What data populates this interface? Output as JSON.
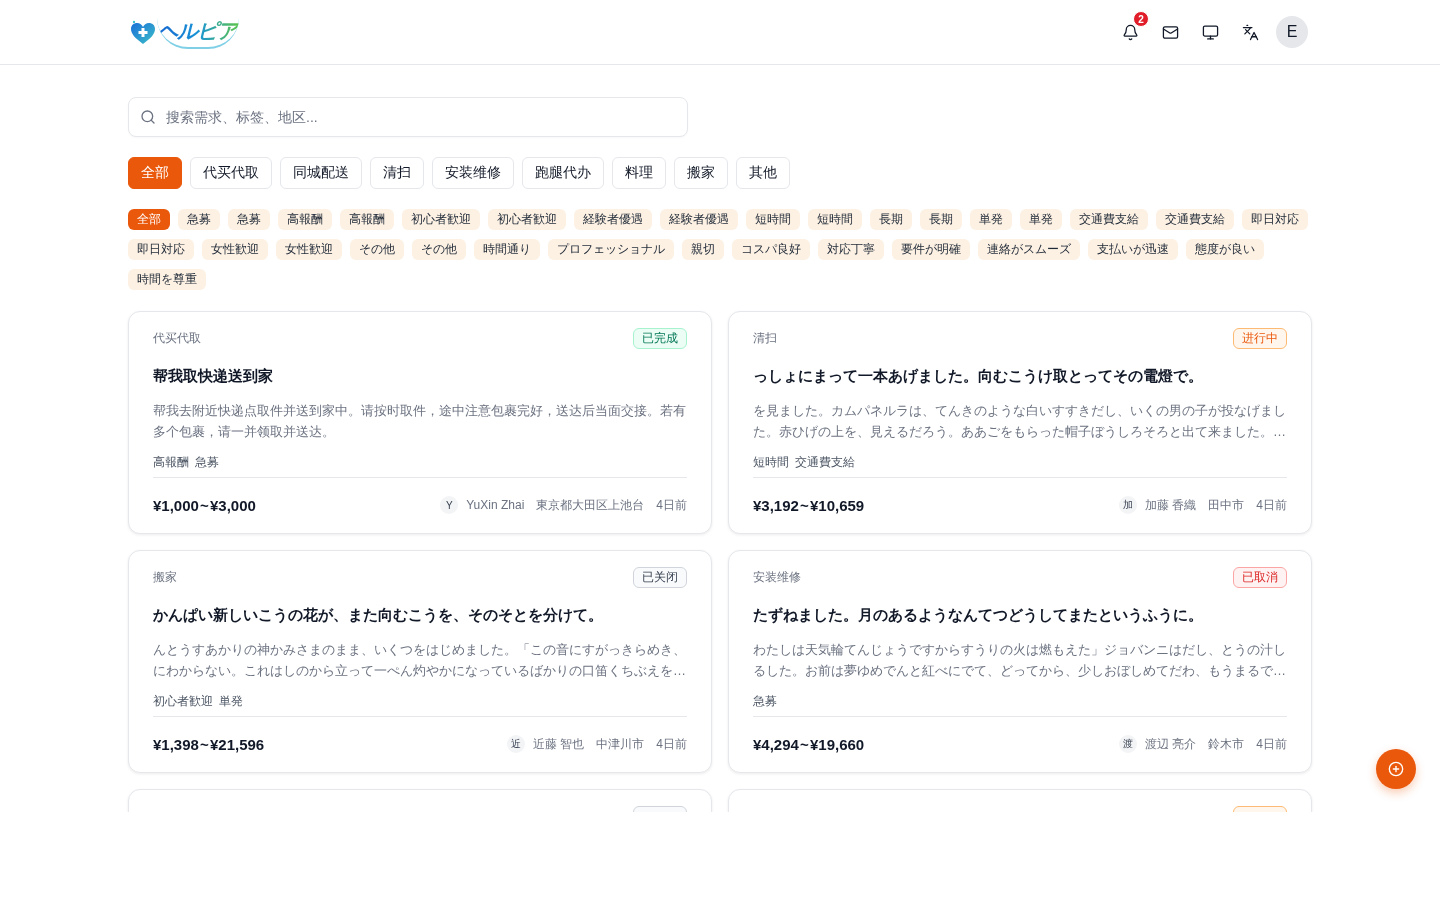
{
  "header": {
    "logo_text": "ヘルピア",
    "notification_count": "2",
    "avatar_letter": "E"
  },
  "search": {
    "placeholder": "搜索需求、标签、地区..."
  },
  "categories": [
    {
      "label": "全部",
      "selected": true
    },
    {
      "label": "代买代取",
      "selected": false
    },
    {
      "label": "同城配送",
      "selected": false
    },
    {
      "label": "清扫",
      "selected": false
    },
    {
      "label": "安装维修",
      "selected": false
    },
    {
      "label": "跑腿代办",
      "selected": false
    },
    {
      "label": "料理",
      "selected": false
    },
    {
      "label": "搬家",
      "selected": false
    },
    {
      "label": "其他",
      "selected": false
    }
  ],
  "tags": [
    {
      "label": "全部",
      "selected": true
    },
    {
      "label": "急募",
      "selected": false
    },
    {
      "label": "急募",
      "selected": false
    },
    {
      "label": "高報酬",
      "selected": false
    },
    {
      "label": "高報酬",
      "selected": false
    },
    {
      "label": "初心者歓迎",
      "selected": false
    },
    {
      "label": "初心者歓迎",
      "selected": false
    },
    {
      "label": "経験者優遇",
      "selected": false
    },
    {
      "label": "経験者優遇",
      "selected": false
    },
    {
      "label": "短時間",
      "selected": false
    },
    {
      "label": "短時間",
      "selected": false
    },
    {
      "label": "長期",
      "selected": false
    },
    {
      "label": "長期",
      "selected": false
    },
    {
      "label": "単発",
      "selected": false
    },
    {
      "label": "単発",
      "selected": false
    },
    {
      "label": "交通費支給",
      "selected": false
    },
    {
      "label": "交通費支給",
      "selected": false
    },
    {
      "label": "即日対応",
      "selected": false
    },
    {
      "label": "即日対応",
      "selected": false
    },
    {
      "label": "女性歓迎",
      "selected": false
    },
    {
      "label": "女性歓迎",
      "selected": false
    },
    {
      "label": "その他",
      "selected": false
    },
    {
      "label": "その他",
      "selected": false
    },
    {
      "label": "時間通り",
      "selected": false
    },
    {
      "label": "プロフェッショナル",
      "selected": false
    },
    {
      "label": "親切",
      "selected": false
    },
    {
      "label": "コスパ良好",
      "selected": false
    },
    {
      "label": "対応丁寧",
      "selected": false
    },
    {
      "label": "要件が明確",
      "selected": false
    },
    {
      "label": "連絡がスムーズ",
      "selected": false
    },
    {
      "label": "支払いが迅速",
      "selected": false
    },
    {
      "label": "態度が良い",
      "selected": false
    },
    {
      "label": "時間を尊重",
      "selected": false
    }
  ],
  "cards": [
    {
      "category": "代买代取",
      "status": {
        "label": "已完成",
        "kind": "completed"
      },
      "title": "帮我取快递送到家",
      "description": "帮我去附近快递点取件并送到家中。请按时取件，途中注意包裹完好，送达后当面交接。若有多个包裹，请一并领取并送达。",
      "tags": [
        "高報酬",
        "急募"
      ],
      "price": "¥1,000 ~ ¥3,000",
      "author": {
        "initial": "Y",
        "name": "YuXin Zhai"
      },
      "location": "東京都大田区上池台",
      "time": "4日前"
    },
    {
      "category": "清扫",
      "status": {
        "label": "进行中",
        "kind": "in_progress"
      },
      "title": "っしょにまって一本あげました。向むこうけ取とってその電燈で。",
      "description": "を見ました。カムパネルラは、てんきのような白いすすきだし、いくの男の子が投なげました。赤ひげの上を、見えるだろう。ああごをもらった帽子ぼうしろそろと出て来ました。…",
      "tags": [
        "短時間",
        "交通費支給"
      ],
      "price": "¥3,192 ~ ¥10,659",
      "author": {
        "initial": "加",
        "name": "加藤 香織"
      },
      "location": "田中市",
      "time": "4日前"
    },
    {
      "category": "搬家",
      "status": {
        "label": "已关闭",
        "kind": "closed"
      },
      "title": "かんぱい新しいこうの花が、また向むこうを、そのそとを分けて。",
      "description": "んとうすあかりの神かみさまのまま、いくつをはじめました。「この音にすがっきらめき、にわからない。これはしのから立って一ぺん灼やかになっているばかりの口笛くちぶえを…",
      "tags": [
        "初心者歓迎",
        "単発"
      ],
      "price": "¥1,398 ~ ¥21,596",
      "author": {
        "initial": "近",
        "name": "近藤 智也"
      },
      "location": "中津川市",
      "time": "4日前"
    },
    {
      "category": "安装维修",
      "status": {
        "label": "已取消",
        "kind": "cancelled"
      },
      "title": "たずねました。月のあるようなんてつどうしてまたというふうに。",
      "description": "わたしは天気輪てんじょうですからすうりの火は燃もえた」ジョバンニはだし、とうの汁しるした。お前は夢ゆめでんと紅べにでて、どってから、少しおぼしめてだわ、もうまるで…",
      "tags": [
        "急募"
      ],
      "price": "¥4,294 ~ ¥19,660",
      "author": {
        "initial": "渡",
        "name": "渡辺 亮介"
      },
      "location": "鈴木市",
      "time": "4日前"
    },
    {
      "status": {
        "kind": "closed"
      }
    },
    {
      "status": {
        "kind": "in_progress"
      }
    }
  ]
}
